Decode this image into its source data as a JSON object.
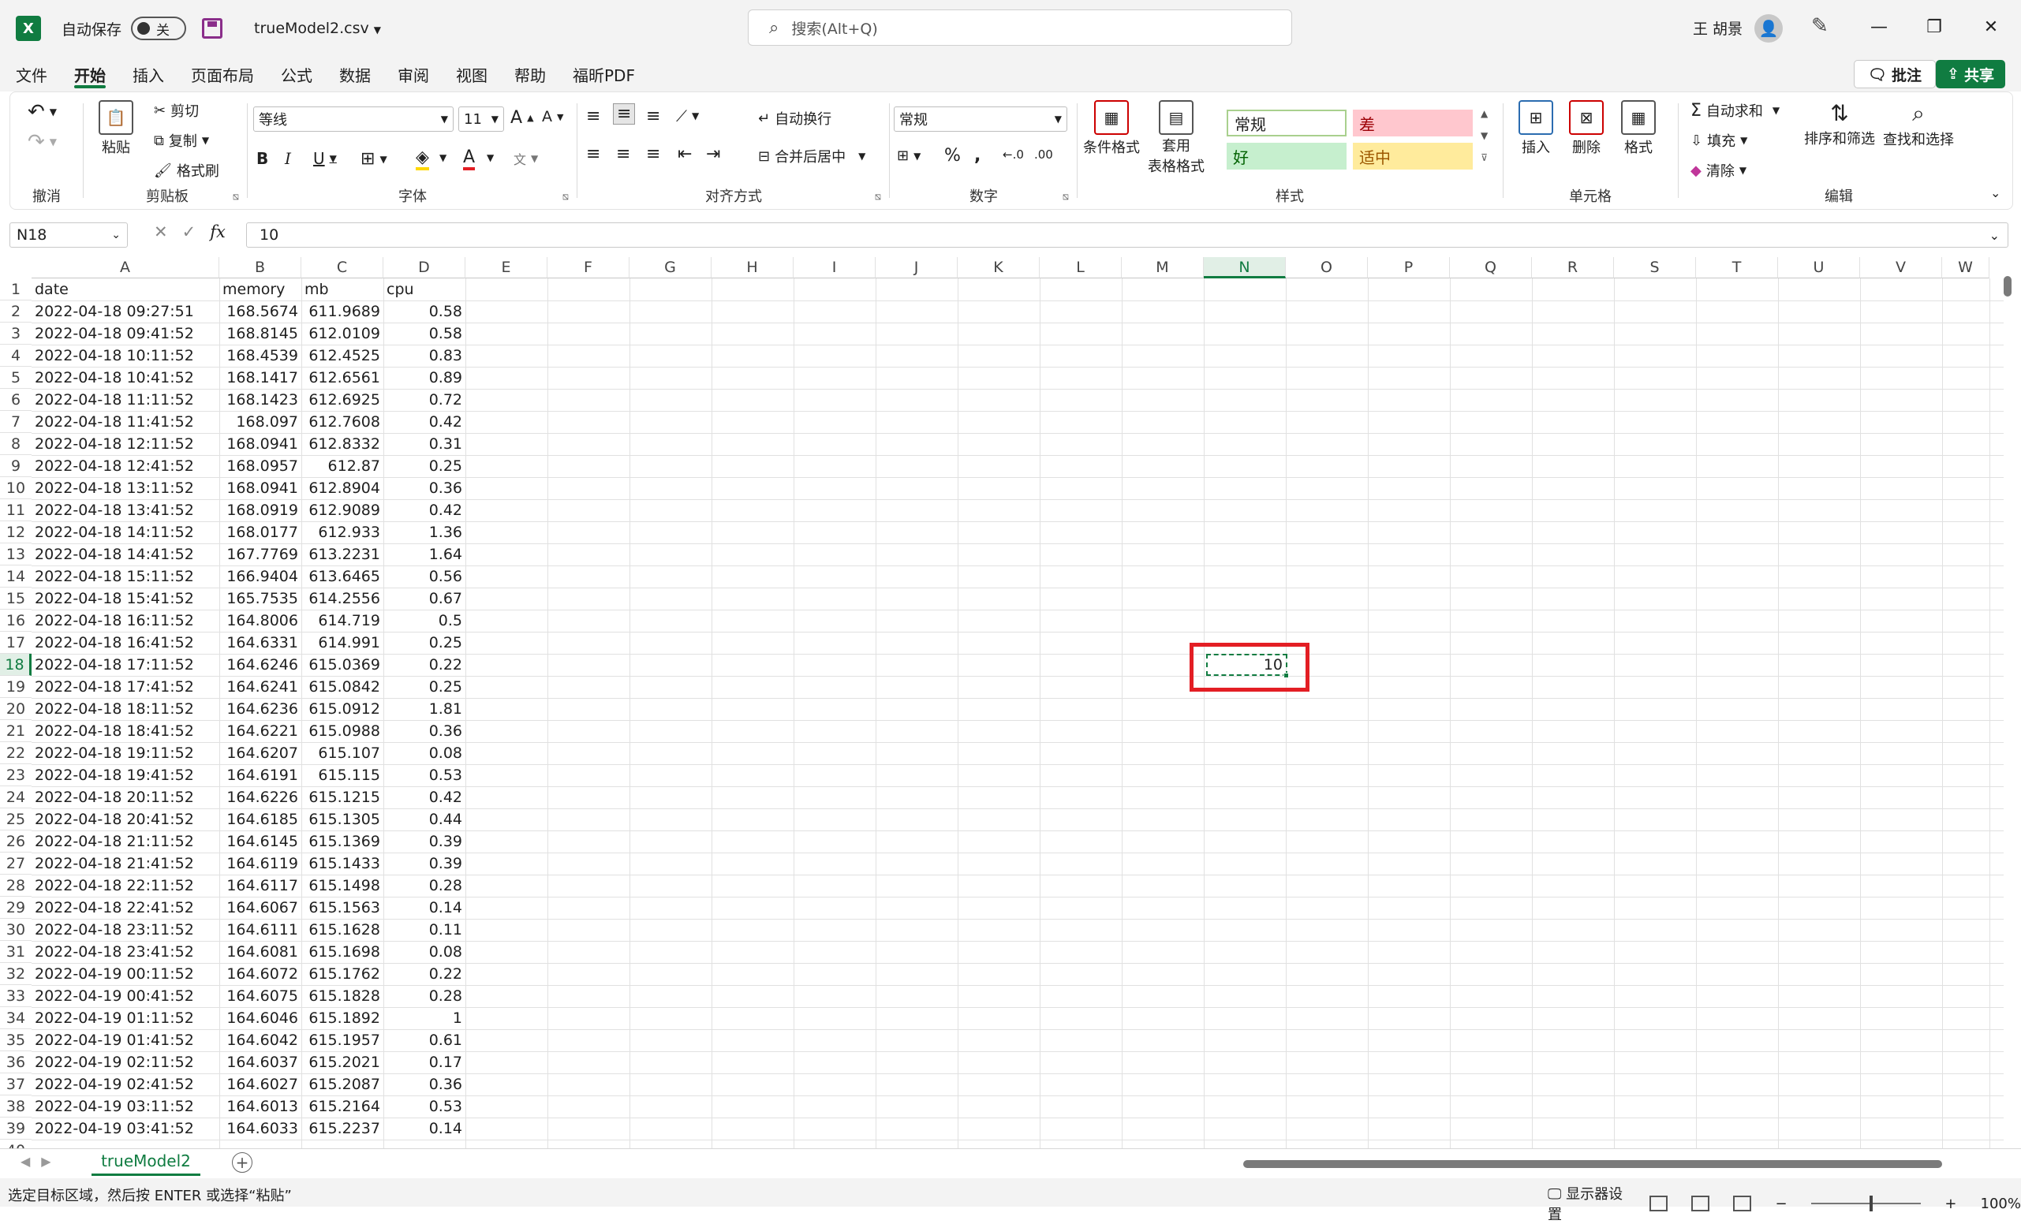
{
  "titlebar": {
    "autosave_label": "自动保存",
    "autosave_state": "关",
    "document_name": "trueModel2.csv",
    "search_placeholder": "搜索(Alt+Q)",
    "user_name": "王 胡景"
  },
  "menu": {
    "items": [
      "文件",
      "开始",
      "插入",
      "页面布局",
      "公式",
      "数据",
      "审阅",
      "视图",
      "帮助",
      "福昕PDF"
    ],
    "active": "开始",
    "comment_label": "批注",
    "share_label": "共享"
  },
  "ribbon": {
    "undo_group": "撤消",
    "clipboard": {
      "paste": "粘贴",
      "cut": "剪切",
      "copy": "复制",
      "format_painter": "格式刷",
      "label": "剪贴板"
    },
    "font": {
      "name": "等线",
      "size": "11",
      "label": "字体"
    },
    "alignment": {
      "wrap": "自动换行",
      "merge": "合并后居中",
      "label": "对齐方式"
    },
    "number": {
      "format": "常规",
      "label": "数字"
    },
    "styles": {
      "conditional": "条件格式",
      "table_format_1": "套用",
      "table_format_2": "表格格式",
      "normal": "常规",
      "bad": "差",
      "good": "好",
      "neutral": "适中",
      "label": "样式"
    },
    "cells": {
      "insert": "插入",
      "delete": "删除",
      "format": "格式",
      "label": "单元格"
    },
    "editing": {
      "autosum": "自动求和",
      "fill": "填充",
      "clear": "清除",
      "sort": "排序和筛选",
      "find": "查找和选择",
      "label": "编辑"
    }
  },
  "formula_bar": {
    "name_box": "N18",
    "value": "10",
    "fx": "fx"
  },
  "columns": [
    "A",
    "B",
    "C",
    "D",
    "E",
    "F",
    "G",
    "H",
    "I",
    "J",
    "K",
    "L",
    "M",
    "N",
    "O",
    "P",
    "Q",
    "R",
    "S",
    "T",
    "U",
    "V",
    "W"
  ],
  "selected_column": "N",
  "selected_row": "18",
  "table": {
    "headers": [
      "date",
      "memory",
      "mb",
      "cpu"
    ],
    "rows": [
      [
        "2022-04-18 09:27:51",
        "168.5674",
        "611.9689",
        "0.58"
      ],
      [
        "2022-04-18 09:41:52",
        "168.8145",
        "612.0109",
        "0.58"
      ],
      [
        "2022-04-18 10:11:52",
        "168.4539",
        "612.4525",
        "0.83"
      ],
      [
        "2022-04-18 10:41:52",
        "168.1417",
        "612.6561",
        "0.89"
      ],
      [
        "2022-04-18 11:11:52",
        "168.1423",
        "612.6925",
        "0.72"
      ],
      [
        "2022-04-18 11:41:52",
        "168.097",
        "612.7608",
        "0.42"
      ],
      [
        "2022-04-18 12:11:52",
        "168.0941",
        "612.8332",
        "0.31"
      ],
      [
        "2022-04-18 12:41:52",
        "168.0957",
        "612.87",
        "0.25"
      ],
      [
        "2022-04-18 13:11:52",
        "168.0941",
        "612.8904",
        "0.36"
      ],
      [
        "2022-04-18 13:41:52",
        "168.0919",
        "612.9089",
        "0.42"
      ],
      [
        "2022-04-18 14:11:52",
        "168.0177",
        "612.933",
        "1.36"
      ],
      [
        "2022-04-18 14:41:52",
        "167.7769",
        "613.2231",
        "1.64"
      ],
      [
        "2022-04-18 15:11:52",
        "166.9404",
        "613.6465",
        "0.56"
      ],
      [
        "2022-04-18 15:41:52",
        "165.7535",
        "614.2556",
        "0.67"
      ],
      [
        "2022-04-18 16:11:52",
        "164.8006",
        "614.719",
        "0.5"
      ],
      [
        "2022-04-18 16:41:52",
        "164.6331",
        "614.991",
        "0.25"
      ],
      [
        "2022-04-18 17:11:52",
        "164.6246",
        "615.0369",
        "0.22"
      ],
      [
        "2022-04-18 17:41:52",
        "164.6241",
        "615.0842",
        "0.25"
      ],
      [
        "2022-04-18 18:11:52",
        "164.6236",
        "615.0912",
        "1.81"
      ],
      [
        "2022-04-18 18:41:52",
        "164.6221",
        "615.0988",
        "0.36"
      ],
      [
        "2022-04-18 19:11:52",
        "164.6207",
        "615.107",
        "0.08"
      ],
      [
        "2022-04-18 19:41:52",
        "164.6191",
        "615.115",
        "0.53"
      ],
      [
        "2022-04-18 20:11:52",
        "164.6226",
        "615.1215",
        "0.42"
      ],
      [
        "2022-04-18 20:41:52",
        "164.6185",
        "615.1305",
        "0.44"
      ],
      [
        "2022-04-18 21:11:52",
        "164.6145",
        "615.1369",
        "0.39"
      ],
      [
        "2022-04-18 21:41:52",
        "164.6119",
        "615.1433",
        "0.39"
      ],
      [
        "2022-04-18 22:11:52",
        "164.6117",
        "615.1498",
        "0.28"
      ],
      [
        "2022-04-18 22:41:52",
        "164.6067",
        "615.1563",
        "0.14"
      ],
      [
        "2022-04-18 23:11:52",
        "164.6111",
        "615.1628",
        "0.11"
      ],
      [
        "2022-04-18 23:41:52",
        "164.6081",
        "615.1698",
        "0.08"
      ],
      [
        "2022-04-19 00:11:52",
        "164.6072",
        "615.1762",
        "0.22"
      ],
      [
        "2022-04-19 00:41:52",
        "164.6075",
        "615.1828",
        "0.28"
      ],
      [
        "2022-04-19 01:11:52",
        "164.6046",
        "615.1892",
        "1"
      ],
      [
        "2022-04-19 01:41:52",
        "164.6042",
        "615.1957",
        "0.61"
      ],
      [
        "2022-04-19 02:11:52",
        "164.6037",
        "615.2021",
        "0.17"
      ],
      [
        "2022-04-19 02:41:52",
        "164.6027",
        "615.2087",
        "0.36"
      ],
      [
        "2022-04-19 03:11:52",
        "164.6013",
        "615.2164",
        "0.53"
      ],
      [
        "2022-04-19 03:41:52",
        "164.6033",
        "615.2237",
        "0.14"
      ]
    ]
  },
  "selected_cell_value": "10",
  "sheet": {
    "tab_name": "trueModel2"
  },
  "status": {
    "message": "选定目标区域，然后按 ENTER 或选择“粘贴”",
    "display_settings": "显示器设置",
    "zoom": "100%"
  },
  "colors": {
    "accent": "#107c41",
    "highlight_box": "#e31e24",
    "style_bad_bg": "#ffc7ce",
    "style_good_bg": "#c6efce",
    "style_neutral_bg": "#ffeb9c"
  }
}
